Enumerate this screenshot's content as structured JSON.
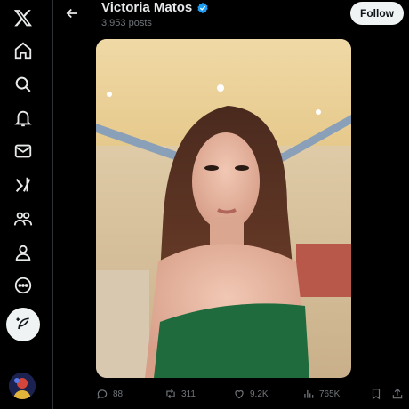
{
  "nav": {
    "items": [
      {
        "icon": "x-logo-icon"
      },
      {
        "icon": "home-icon"
      },
      {
        "icon": "search-icon"
      },
      {
        "icon": "notifications-bell-icon"
      },
      {
        "icon": "messages-envelope-icon"
      },
      {
        "icon": "grok-icon"
      },
      {
        "icon": "communities-icon"
      },
      {
        "icon": "profile-icon"
      },
      {
        "icon": "more-circle-icon"
      }
    ],
    "compose_icon": "compose-feather-icon"
  },
  "header": {
    "name": "Victoria Matos",
    "posts_count": "3,953 posts",
    "follow_label": "Follow",
    "verified": true,
    "accent": "#1d9bf0"
  },
  "actions": {
    "replies": "88",
    "reposts": "311",
    "likes": "9.2K",
    "views": "765K"
  },
  "colors": {
    "background": "#000000",
    "text_primary": "#e7e9ea",
    "text_secondary": "#71767b",
    "border": "#2f3336",
    "button_bg": "#eff3f4"
  }
}
